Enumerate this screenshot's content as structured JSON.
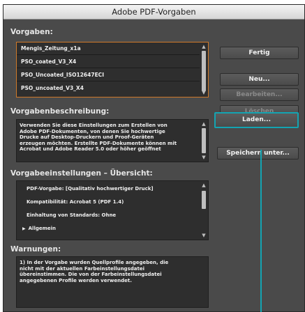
{
  "window": {
    "title": "Adobe PDF-Vorgaben"
  },
  "presets": {
    "label": "Vorgaben:",
    "items": [
      "Mengis_Zeitung_x1a",
      "PSO_coated_V3_X4",
      "PSO_Uncoated_ISO12647ECI",
      "PSO_uncoated_V3_X4"
    ]
  },
  "description": {
    "label": "Vorgabenbeschreibung:",
    "lines": [
      "Verwenden Sie diese Einstellungen zum Erstellen von",
      "Adobe PDF-Dokumenten, von denen Sie hochwertige",
      "Drucke auf Desktop-Druckern und Proof-Geräten",
      "erzeugen möchten. Erstellte PDF-Dokumente können mit",
      "Acrobat und Adobe Reader 5.0 oder höher geöffnet"
    ]
  },
  "overview": {
    "label": "Vorgabeeinstellungen – Übersicht:",
    "rows": [
      "PDF-Vorgabe: [Qualitativ hochwertiger Druck]",
      "Kompatibilität: Acrobat 5 (PDF 1.4)",
      "Einhaltung von Standards: Ohne",
      "Allgemein"
    ],
    "expand_glyph": "▶"
  },
  "warnings": {
    "label": "Warnungen:",
    "lines": [
      "1) In der Vorgabe wurden Quellprofile angegeben, die",
      "nicht mit der aktuellen Farbeinstellungsdatei",
      "übereinstimmen. Die von der Farbeinstellungsdatei",
      "angegebenen Profile werden verwendet."
    ]
  },
  "buttons": {
    "done": "Fertig",
    "new": "Neu...",
    "edit": "Bearbeiten...",
    "delete": "Löschen",
    "load": "Laden...",
    "save_as": "Speichern unter..."
  },
  "colors": {
    "selection_border": "#d07a2a",
    "callout": "#13a4b2"
  }
}
